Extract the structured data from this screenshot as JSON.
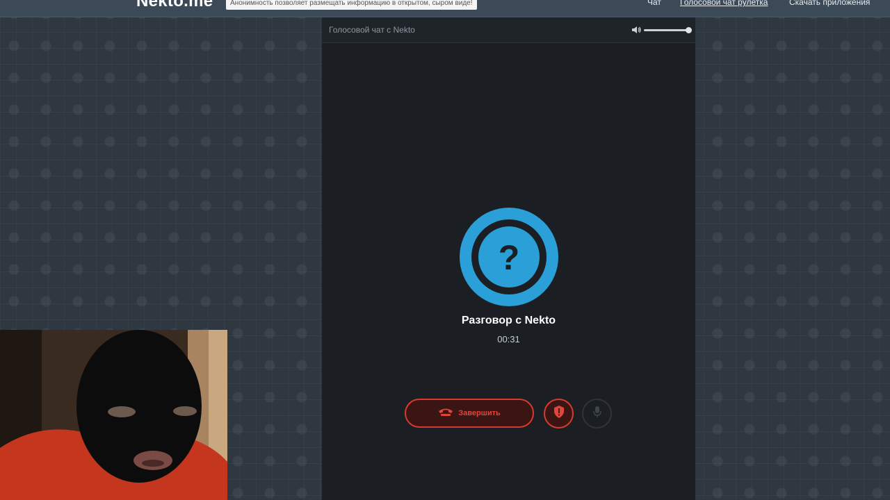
{
  "navbar": {
    "logo": "Nekto.me",
    "tagline": "Анонимность позволяет размещать информацию в открытом, сыром виде!",
    "links": [
      "Чат",
      "Голосовой чат рулетка",
      "Скачать приложения"
    ]
  },
  "panel": {
    "title": "Голосовой чат с Nekto",
    "volume_level": 1.0,
    "avatar_symbol": "?",
    "conversation_title": "Разговор с Nekto",
    "timer": "00:31",
    "end_button_label": "Завершить"
  },
  "colors": {
    "accent_blue": "#2a9fd8",
    "danger_red": "#d93a2f",
    "panel_bg": "#1b1f23",
    "page_bg": "#2f3841"
  },
  "icons": {
    "volume": "speaker-icon",
    "avatar": "question-mark-icon",
    "end": "phone-hangup-icon",
    "report": "shield-alert-icon",
    "mic": "microphone-icon"
  }
}
